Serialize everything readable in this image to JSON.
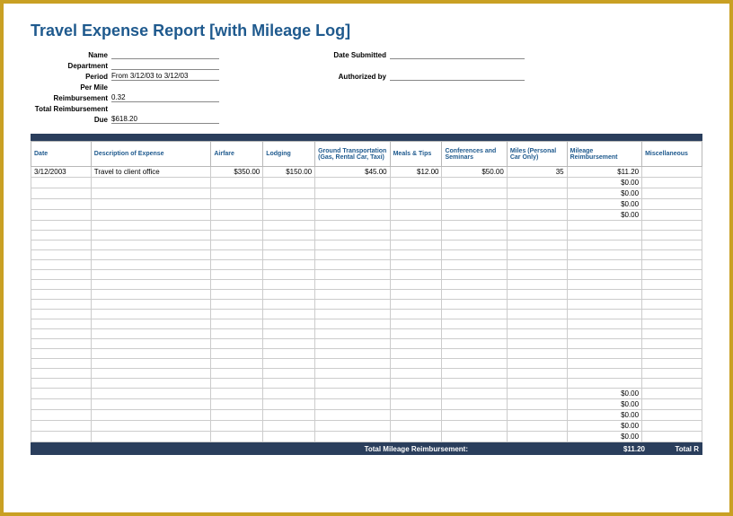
{
  "title": "Travel Expense Report [with Mileage Log]",
  "header": {
    "left": [
      {
        "label": "Name",
        "value": "",
        "underline": true
      },
      {
        "label": "Department",
        "value": "",
        "underline": true
      },
      {
        "label": "Period",
        "value": "From 3/12/03 to 3/12/03",
        "underline": true
      },
      {
        "label": "Per Mile",
        "value": "",
        "underline": false
      },
      {
        "label": "Reimbursement",
        "value": "0.32",
        "underline": true
      },
      {
        "label": "Total Reimbursement",
        "value": "",
        "underline": false
      },
      {
        "label": "Due",
        "value": "$618.20",
        "underline": true
      }
    ],
    "right": [
      {
        "label": "Date Submitted",
        "value": "",
        "underline": true
      },
      {
        "label": "",
        "value": "",
        "underline": false
      },
      {
        "label": "Authorized by",
        "value": "",
        "underline": true
      }
    ]
  },
  "columns": [
    "Date",
    "Description of Expense",
    "Airfare",
    "Lodging",
    "Ground Transportation (Gas, Rental Car, Taxi)",
    "Meals & Tips",
    "Conferences and Seminars",
    "Miles (Personal Car Only)",
    "Mileage Reimbursement",
    "Miscellaneous"
  ],
  "rows": [
    {
      "date": "3/12/2003",
      "desc": "Travel to client office",
      "airfare": "$350.00",
      "lodging": "$150.00",
      "ground": "$45.00",
      "meals": "$12.00",
      "conf": "$50.00",
      "miles": "35",
      "reimb": "$11.20",
      "misc": ""
    },
    {
      "date": "",
      "desc": "",
      "airfare": "",
      "lodging": "",
      "ground": "",
      "meals": "",
      "conf": "",
      "miles": "",
      "reimb": "$0.00",
      "misc": ""
    },
    {
      "date": "",
      "desc": "",
      "airfare": "",
      "lodging": "",
      "ground": "",
      "meals": "",
      "conf": "",
      "miles": "",
      "reimb": "$0.00",
      "misc": ""
    },
    {
      "date": "",
      "desc": "",
      "airfare": "",
      "lodging": "",
      "ground": "",
      "meals": "",
      "conf": "",
      "miles": "",
      "reimb": "$0.00",
      "misc": ""
    },
    {
      "date": "",
      "desc": "",
      "airfare": "",
      "lodging": "",
      "ground": "",
      "meals": "",
      "conf": "",
      "miles": "",
      "reimb": "$0.00",
      "misc": ""
    },
    {
      "date": "",
      "desc": "",
      "airfare": "",
      "lodging": "",
      "ground": "",
      "meals": "",
      "conf": "",
      "miles": "",
      "reimb": "",
      "misc": ""
    },
    {
      "date": "",
      "desc": "",
      "airfare": "",
      "lodging": "",
      "ground": "",
      "meals": "",
      "conf": "",
      "miles": "",
      "reimb": "",
      "misc": ""
    },
    {
      "date": "",
      "desc": "",
      "airfare": "",
      "lodging": "",
      "ground": "",
      "meals": "",
      "conf": "",
      "miles": "",
      "reimb": "",
      "misc": ""
    },
    {
      "date": "",
      "desc": "",
      "airfare": "",
      "lodging": "",
      "ground": "",
      "meals": "",
      "conf": "",
      "miles": "",
      "reimb": "",
      "misc": ""
    },
    {
      "date": "",
      "desc": "",
      "airfare": "",
      "lodging": "",
      "ground": "",
      "meals": "",
      "conf": "",
      "miles": "",
      "reimb": "",
      "misc": ""
    },
    {
      "date": "",
      "desc": "",
      "airfare": "",
      "lodging": "",
      "ground": "",
      "meals": "",
      "conf": "",
      "miles": "",
      "reimb": "",
      "misc": ""
    },
    {
      "date": "",
      "desc": "",
      "airfare": "",
      "lodging": "",
      "ground": "",
      "meals": "",
      "conf": "",
      "miles": "",
      "reimb": "",
      "misc": ""
    },
    {
      "date": "",
      "desc": "",
      "airfare": "",
      "lodging": "",
      "ground": "",
      "meals": "",
      "conf": "",
      "miles": "",
      "reimb": "",
      "misc": ""
    },
    {
      "date": "",
      "desc": "",
      "airfare": "",
      "lodging": "",
      "ground": "",
      "meals": "",
      "conf": "",
      "miles": "",
      "reimb": "",
      "misc": ""
    },
    {
      "date": "",
      "desc": "",
      "airfare": "",
      "lodging": "",
      "ground": "",
      "meals": "",
      "conf": "",
      "miles": "",
      "reimb": "",
      "misc": ""
    },
    {
      "date": "",
      "desc": "",
      "airfare": "",
      "lodging": "",
      "ground": "",
      "meals": "",
      "conf": "",
      "miles": "",
      "reimb": "",
      "misc": ""
    },
    {
      "date": "",
      "desc": "",
      "airfare": "",
      "lodging": "",
      "ground": "",
      "meals": "",
      "conf": "",
      "miles": "",
      "reimb": "",
      "misc": ""
    },
    {
      "date": "",
      "desc": "",
      "airfare": "",
      "lodging": "",
      "ground": "",
      "meals": "",
      "conf": "",
      "miles": "",
      "reimb": "",
      "misc": ""
    },
    {
      "date": "",
      "desc": "",
      "airfare": "",
      "lodging": "",
      "ground": "",
      "meals": "",
      "conf": "",
      "miles": "",
      "reimb": "",
      "misc": ""
    },
    {
      "date": "",
      "desc": "",
      "airfare": "",
      "lodging": "",
      "ground": "",
      "meals": "",
      "conf": "",
      "miles": "",
      "reimb": "",
      "misc": ""
    },
    {
      "date": "",
      "desc": "",
      "airfare": "",
      "lodging": "",
      "ground": "",
      "meals": "",
      "conf": "",
      "miles": "",
      "reimb": "",
      "misc": ""
    },
    {
      "date": "",
      "desc": "",
      "airfare": "",
      "lodging": "",
      "ground": "",
      "meals": "",
      "conf": "",
      "miles": "",
      "reimb": "",
      "misc": ""
    },
    {
      "date": "",
      "desc": "",
      "airfare": "",
      "lodging": "",
      "ground": "",
      "meals": "",
      "conf": "",
      "miles": "",
      "reimb": "$0.00",
      "misc": ""
    },
    {
      "date": "",
      "desc": "",
      "airfare": "",
      "lodging": "",
      "ground": "",
      "meals": "",
      "conf": "",
      "miles": "",
      "reimb": "$0.00",
      "misc": ""
    },
    {
      "date": "",
      "desc": "",
      "airfare": "",
      "lodging": "",
      "ground": "",
      "meals": "",
      "conf": "",
      "miles": "",
      "reimb": "$0.00",
      "misc": ""
    },
    {
      "date": "",
      "desc": "",
      "airfare": "",
      "lodging": "",
      "ground": "",
      "meals": "",
      "conf": "",
      "miles": "",
      "reimb": "$0.00",
      "misc": ""
    },
    {
      "date": "",
      "desc": "",
      "airfare": "",
      "lodging": "",
      "ground": "",
      "meals": "",
      "conf": "",
      "miles": "",
      "reimb": "$0.00",
      "misc": ""
    }
  ],
  "footer": {
    "label": "Total Mileage Reimbursement:",
    "value": "$11.20",
    "total_label": "Total R"
  }
}
